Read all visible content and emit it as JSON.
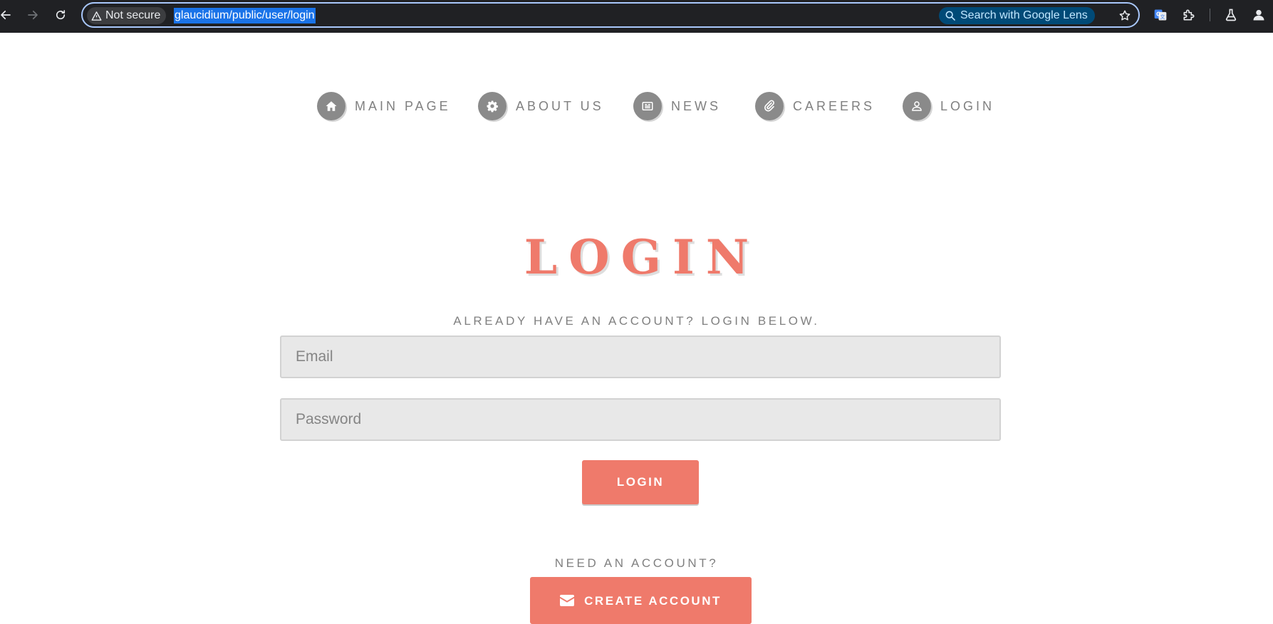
{
  "browser": {
    "security_label": "Not secure",
    "url": "glaucidium/public/user/login",
    "lens_label": "Search with Google Lens"
  },
  "nav": {
    "items": [
      {
        "label": "MAIN PAGE",
        "icon": "home-icon"
      },
      {
        "label": "ABOUT US",
        "icon": "gear-icon"
      },
      {
        "label": "NEWS",
        "icon": "newspaper-icon"
      },
      {
        "label": "CAREERS",
        "icon": "paperclip-icon"
      },
      {
        "label": "LOGIN",
        "icon": "user-icon"
      }
    ]
  },
  "login": {
    "title": "LOGIN",
    "subtitle": "ALREADY HAVE AN ACCOUNT? LOGIN BELOW.",
    "email_placeholder": "Email",
    "password_placeholder": "Password",
    "submit_label": "LOGIN",
    "need_account": "NEED AN ACCOUNT?",
    "create_label": "CREATE ACCOUNT",
    "create_icon": "envelope-icon"
  },
  "colors": {
    "accent": "#ef7a6b",
    "nav_icon": "#8a8a8a",
    "muted_text": "#808080",
    "field_bg": "#e8e8e8"
  }
}
